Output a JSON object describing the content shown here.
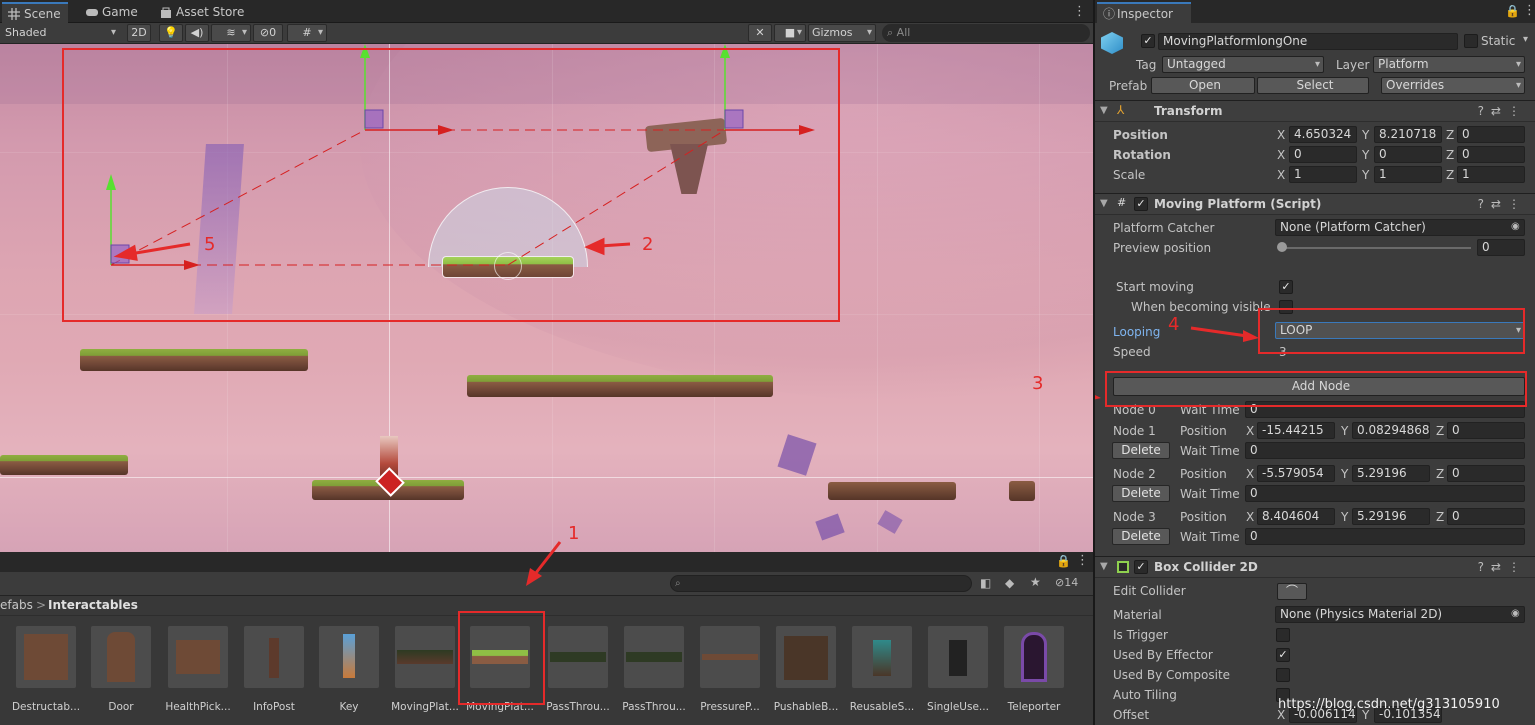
{
  "tabs": {
    "scene": "Scene",
    "game": "Game",
    "asset_store": "Asset Store",
    "inspector": "Inspector"
  },
  "toolbar": {
    "shading": "Shaded",
    "mode_2d": "2D",
    "hidden_count": "0",
    "gizmos": "Gizmos",
    "search_placeholder": "All"
  },
  "project": {
    "breadcrumb_parent": "efabs",
    "breadcrumb_sep": ">",
    "breadcrumb_current": "Interactables",
    "visible_count": "14",
    "assets": [
      "Destructab...",
      "Door",
      "HealthPick...",
      "InfoPost",
      "Key",
      "MovingPlat...",
      "MovingPlat...",
      "PassThrou...",
      "PassThrou...",
      "PressureP...",
      "PushableB...",
      "ReusableS...",
      "SingleUse...",
      "Teleporter"
    ]
  },
  "inspector": {
    "object_name": "MovingPlatformlongOne",
    "static_label": "Static",
    "tag_label": "Tag",
    "tag_value": "Untagged",
    "layer_label": "Layer",
    "layer_value": "Platform",
    "prefab_label": "Prefab",
    "open": "Open",
    "select": "Select",
    "overrides": "Overrides",
    "transform": {
      "title": "Transform",
      "position_label": "Position",
      "rotation_label": "Rotation",
      "scale_label": "Scale",
      "position": {
        "x": "4.650324",
        "y": "8.210718",
        "z": "0"
      },
      "rotation": {
        "x": "0",
        "y": "0",
        "z": "0"
      },
      "scale": {
        "x": "1",
        "y": "1",
        "z": "1"
      }
    },
    "moving_platform": {
      "title": "Moving Platform (Script)",
      "platform_catcher_label": "Platform Catcher",
      "platform_catcher_value": "None (Platform Catcher)",
      "preview_label": "Preview position",
      "preview_value": "0",
      "start_moving_label": "Start moving",
      "when_visible_label": "When becoming visible",
      "looping_label": "Looping",
      "looping_value": "LOOP",
      "speed_label": "Speed",
      "speed_value": "3",
      "add_node": "Add Node",
      "position_label": "Position",
      "wait_label": "Wait Time",
      "delete": "Delete",
      "nodes": [
        {
          "name": "Node 0",
          "wait": "0"
        },
        {
          "name": "Node 1",
          "x": "-15.44215",
          "y": "0.08294868",
          "z": "0",
          "wait": "0"
        },
        {
          "name": "Node 2",
          "x": "-5.579054",
          "y": "5.29196",
          "z": "0",
          "wait": "0"
        },
        {
          "name": "Node 3",
          "x": "8.404604",
          "y": "5.29196",
          "z": "0",
          "wait": "0"
        }
      ]
    },
    "box_collider": {
      "title": "Box Collider 2D",
      "edit_collider": "Edit Collider",
      "material_label": "Material",
      "material_value": "None (Physics Material 2D)",
      "is_trigger": "Is Trigger",
      "used_by_effector": "Used By Effector",
      "used_by_composite": "Used By Composite",
      "auto_tiling": "Auto Tiling",
      "offset_label": "Offset",
      "offset_x": "-0.006114",
      "offset_y": "-0.101354"
    }
  },
  "axes": {
    "x": "X",
    "y": "Y",
    "z": "Z"
  },
  "annotations": {
    "a1": "1",
    "a2": "2",
    "a3": "3",
    "a4": "4",
    "a5": "5"
  },
  "watermark": "https://blog.csdn.net/g313105910",
  "colors": {
    "accent": "#3a79bb",
    "annotation": "#e52a2a",
    "looping_label": "#7fb5f0"
  }
}
